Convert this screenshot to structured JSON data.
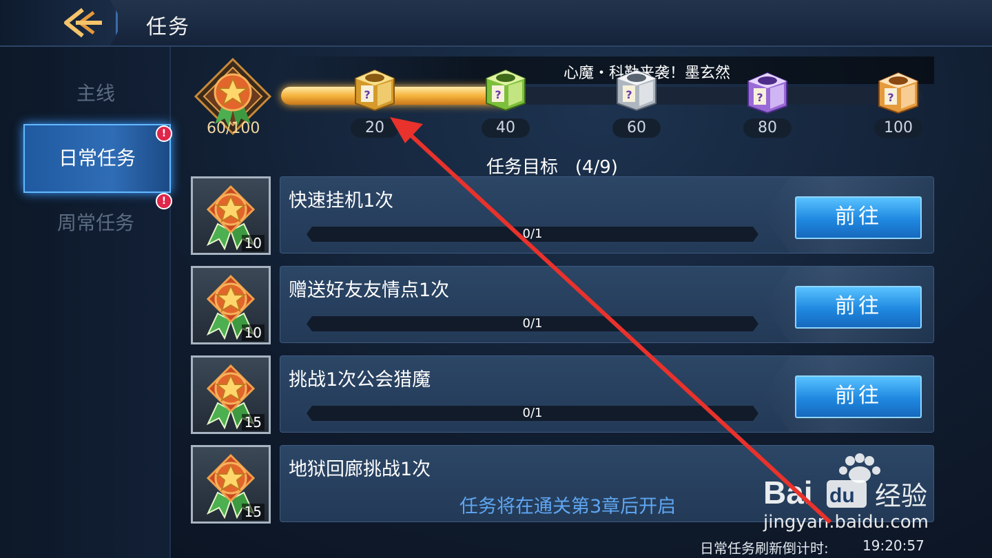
{
  "header": {
    "title": "任务"
  },
  "sidebar": {
    "tabs": [
      {
        "label": "主线",
        "selected": false,
        "badge": ""
      },
      {
        "label": "日常任务",
        "selected": true,
        "badge": "!"
      },
      {
        "label": "周常任务",
        "selected": false,
        "badge": "!"
      }
    ]
  },
  "progress": {
    "marquee": "心魔・科勒来袭！墨玄然",
    "score": "60/100",
    "current": 60,
    "max": 100,
    "milestones": [
      {
        "value": "20",
        "chest": "gold"
      },
      {
        "value": "40",
        "chest": "green"
      },
      {
        "value": "60",
        "chest": "silver"
      },
      {
        "value": "80",
        "chest": "purple"
      },
      {
        "value": "100",
        "chest": "orange"
      }
    ]
  },
  "goals": {
    "title": "任务目标",
    "count": "(4/9)"
  },
  "tasks": [
    {
      "name": "快速挂机1次",
      "reward": "10",
      "progress": "0/1",
      "button": "前往"
    },
    {
      "name": "赠送好友友情点1次",
      "reward": "10",
      "progress": "0/1",
      "button": "前往"
    },
    {
      "name": "挑战1次公会猎魔",
      "reward": "15",
      "progress": "0/1",
      "button": "前往"
    },
    {
      "name": "地狱回廊挑战1次",
      "reward": "15",
      "locked_text": "任务将在通关第3章后开启"
    }
  ],
  "footer": {
    "countdown_label": "日常任务刷新倒计时:",
    "countdown_time": "19:20:57"
  },
  "watermark": {
    "brand": "Bai du 经验",
    "url": "jingyan.baidu.com"
  },
  "colors": {
    "accent_blue": "#1f88e0",
    "progress_gold": "#f6b43c",
    "badge_red": "#e0264a",
    "arrow_red": "#e8322b"
  }
}
